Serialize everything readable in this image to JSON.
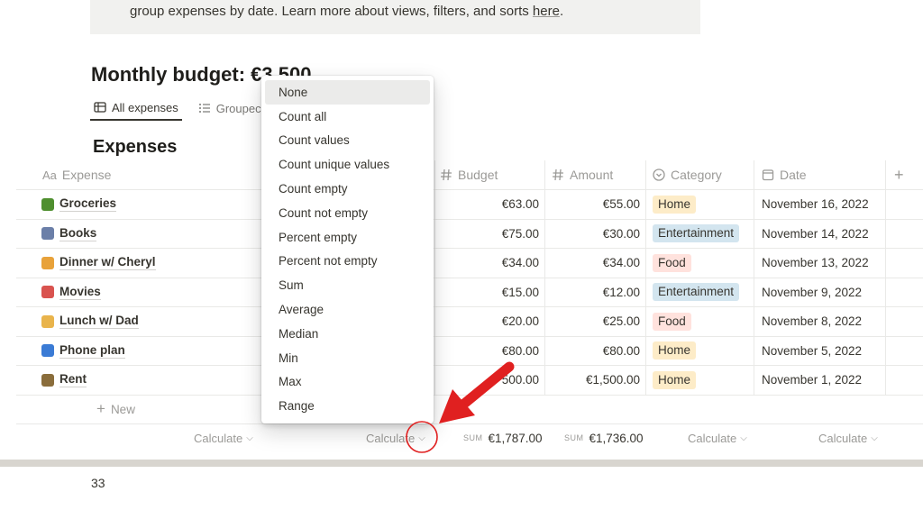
{
  "callout": {
    "text": "group expenses by date. Learn more about views, filters, and sorts ",
    "link": "here",
    "end": "."
  },
  "page_title": "Monthly budget: €3,500",
  "tabs": [
    {
      "label": "All expenses",
      "icon": "table-icon",
      "active": true
    },
    {
      "label": "Groupec",
      "icon": "list-icon",
      "active": false
    }
  ],
  "section_title": "Expenses",
  "columns": {
    "expense": "Expense",
    "expense_prefix": "Aa",
    "budget": "Budget",
    "amount": "Amount",
    "category": "Category",
    "date": "Date",
    "add": "+"
  },
  "rows": [
    {
      "name": "Groceries",
      "emoji_color": "#4f8f2f",
      "budget": "€63.00",
      "amount": "€55.00",
      "category": "Home",
      "cat_bg": "#fdecc8",
      "date": "November 16, 2022"
    },
    {
      "name": "Books",
      "emoji_color": "#6b7fa8",
      "budget": "€75.00",
      "amount": "€30.00",
      "category": "Entertainment",
      "cat_bg": "#d3e5ef",
      "date": "November 14, 2022"
    },
    {
      "name": "Dinner w/ Cheryl",
      "emoji_color": "#e8a23a",
      "budget": "€34.00",
      "amount": "€34.00",
      "category": "Food",
      "cat_bg": "#ffe2dd",
      "date": "November 13, 2022"
    },
    {
      "name": "Movies",
      "emoji_color": "#d9534f",
      "budget": "€15.00",
      "amount": "€12.00",
      "category": "Entertainment",
      "cat_bg": "#d3e5ef",
      "date": "November 9, 2022"
    },
    {
      "name": "Lunch w/ Dad",
      "emoji_color": "#e9b44c",
      "budget": "€20.00",
      "amount": "€25.00",
      "category": "Food",
      "cat_bg": "#ffe2dd",
      "date": "November 8, 2022"
    },
    {
      "name": "Phone plan",
      "emoji_color": "#3a7bd5",
      "budget": "€80.00",
      "amount": "€80.00",
      "category": "Home",
      "cat_bg": "#fdecc8",
      "date": "November 5, 2022"
    },
    {
      "name": "Rent",
      "emoji_color": "#8a6d3b",
      "budget": "500.00",
      "amount": "€1,500.00",
      "category": "Home",
      "cat_bg": "#fdecc8",
      "date": "November 1, 2022"
    }
  ],
  "new_label": "New",
  "calc": {
    "label": "Calculate",
    "sum_label": "SUM",
    "budget_sum": "€1,787.00",
    "amount_sum": "€1,736.00"
  },
  "menu": {
    "items": [
      "None",
      "Count all",
      "Count values",
      "Count unique values",
      "Count empty",
      "Count not empty",
      "Percent empty",
      "Percent not empty",
      "Sum",
      "Average",
      "Median",
      "Min",
      "Max",
      "Range"
    ],
    "highlighted": "None"
  },
  "page_number": "33",
  "colors": {
    "annotation": "#e02020",
    "text": "#37352f",
    "muted": "#9b9a97"
  }
}
